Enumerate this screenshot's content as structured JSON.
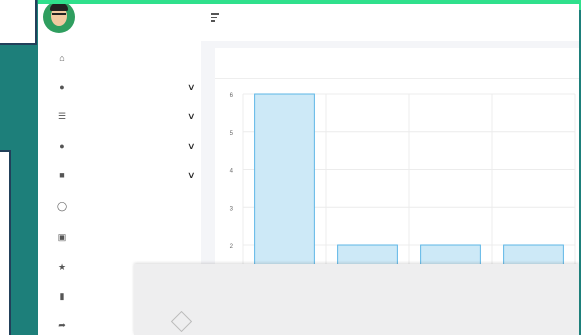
{
  "sidebar": {
    "items": [
      {
        "icon": "home-icon",
        "label": "",
        "chevron": false
      },
      {
        "icon": "user-icon",
        "label": "",
        "chevron": true
      },
      {
        "icon": "layers-icon",
        "label": "",
        "chevron": true
      },
      {
        "icon": "users-icon",
        "label": "",
        "chevron": true
      },
      {
        "icon": "briefcase-icon",
        "label": "",
        "chevron": true
      },
      {
        "icon": "chat-icon",
        "label": "",
        "chevron": false
      },
      {
        "icon": "document-icon",
        "label": "",
        "chevron": false
      },
      {
        "icon": "star-icon",
        "label": "",
        "chevron": false
      },
      {
        "icon": "bookmark-icon",
        "label": "",
        "chevron": false
      },
      {
        "icon": "share-icon",
        "label": "",
        "chevron": false
      }
    ]
  },
  "main": {
    "card_title": ""
  },
  "chart_data": {
    "type": "bar",
    "categories": [
      "",
      "",
      "",
      ""
    ],
    "values": [
      6,
      2,
      2,
      2
    ],
    "ylim": [
      0,
      6
    ],
    "yticks": [
      "2",
      "3",
      "4",
      "5",
      "6"
    ],
    "grid": true,
    "bar_color": "#cde9f7",
    "bar_border": "#5cb6e6"
  },
  "promo": {
    "title": "",
    "lines": [
      "",
      "",
      "",
      ""
    ]
  },
  "colors": {
    "background": "#1d7f7a",
    "highlight": "#2fe08c",
    "avatar_bg": "#2f9e5f"
  }
}
